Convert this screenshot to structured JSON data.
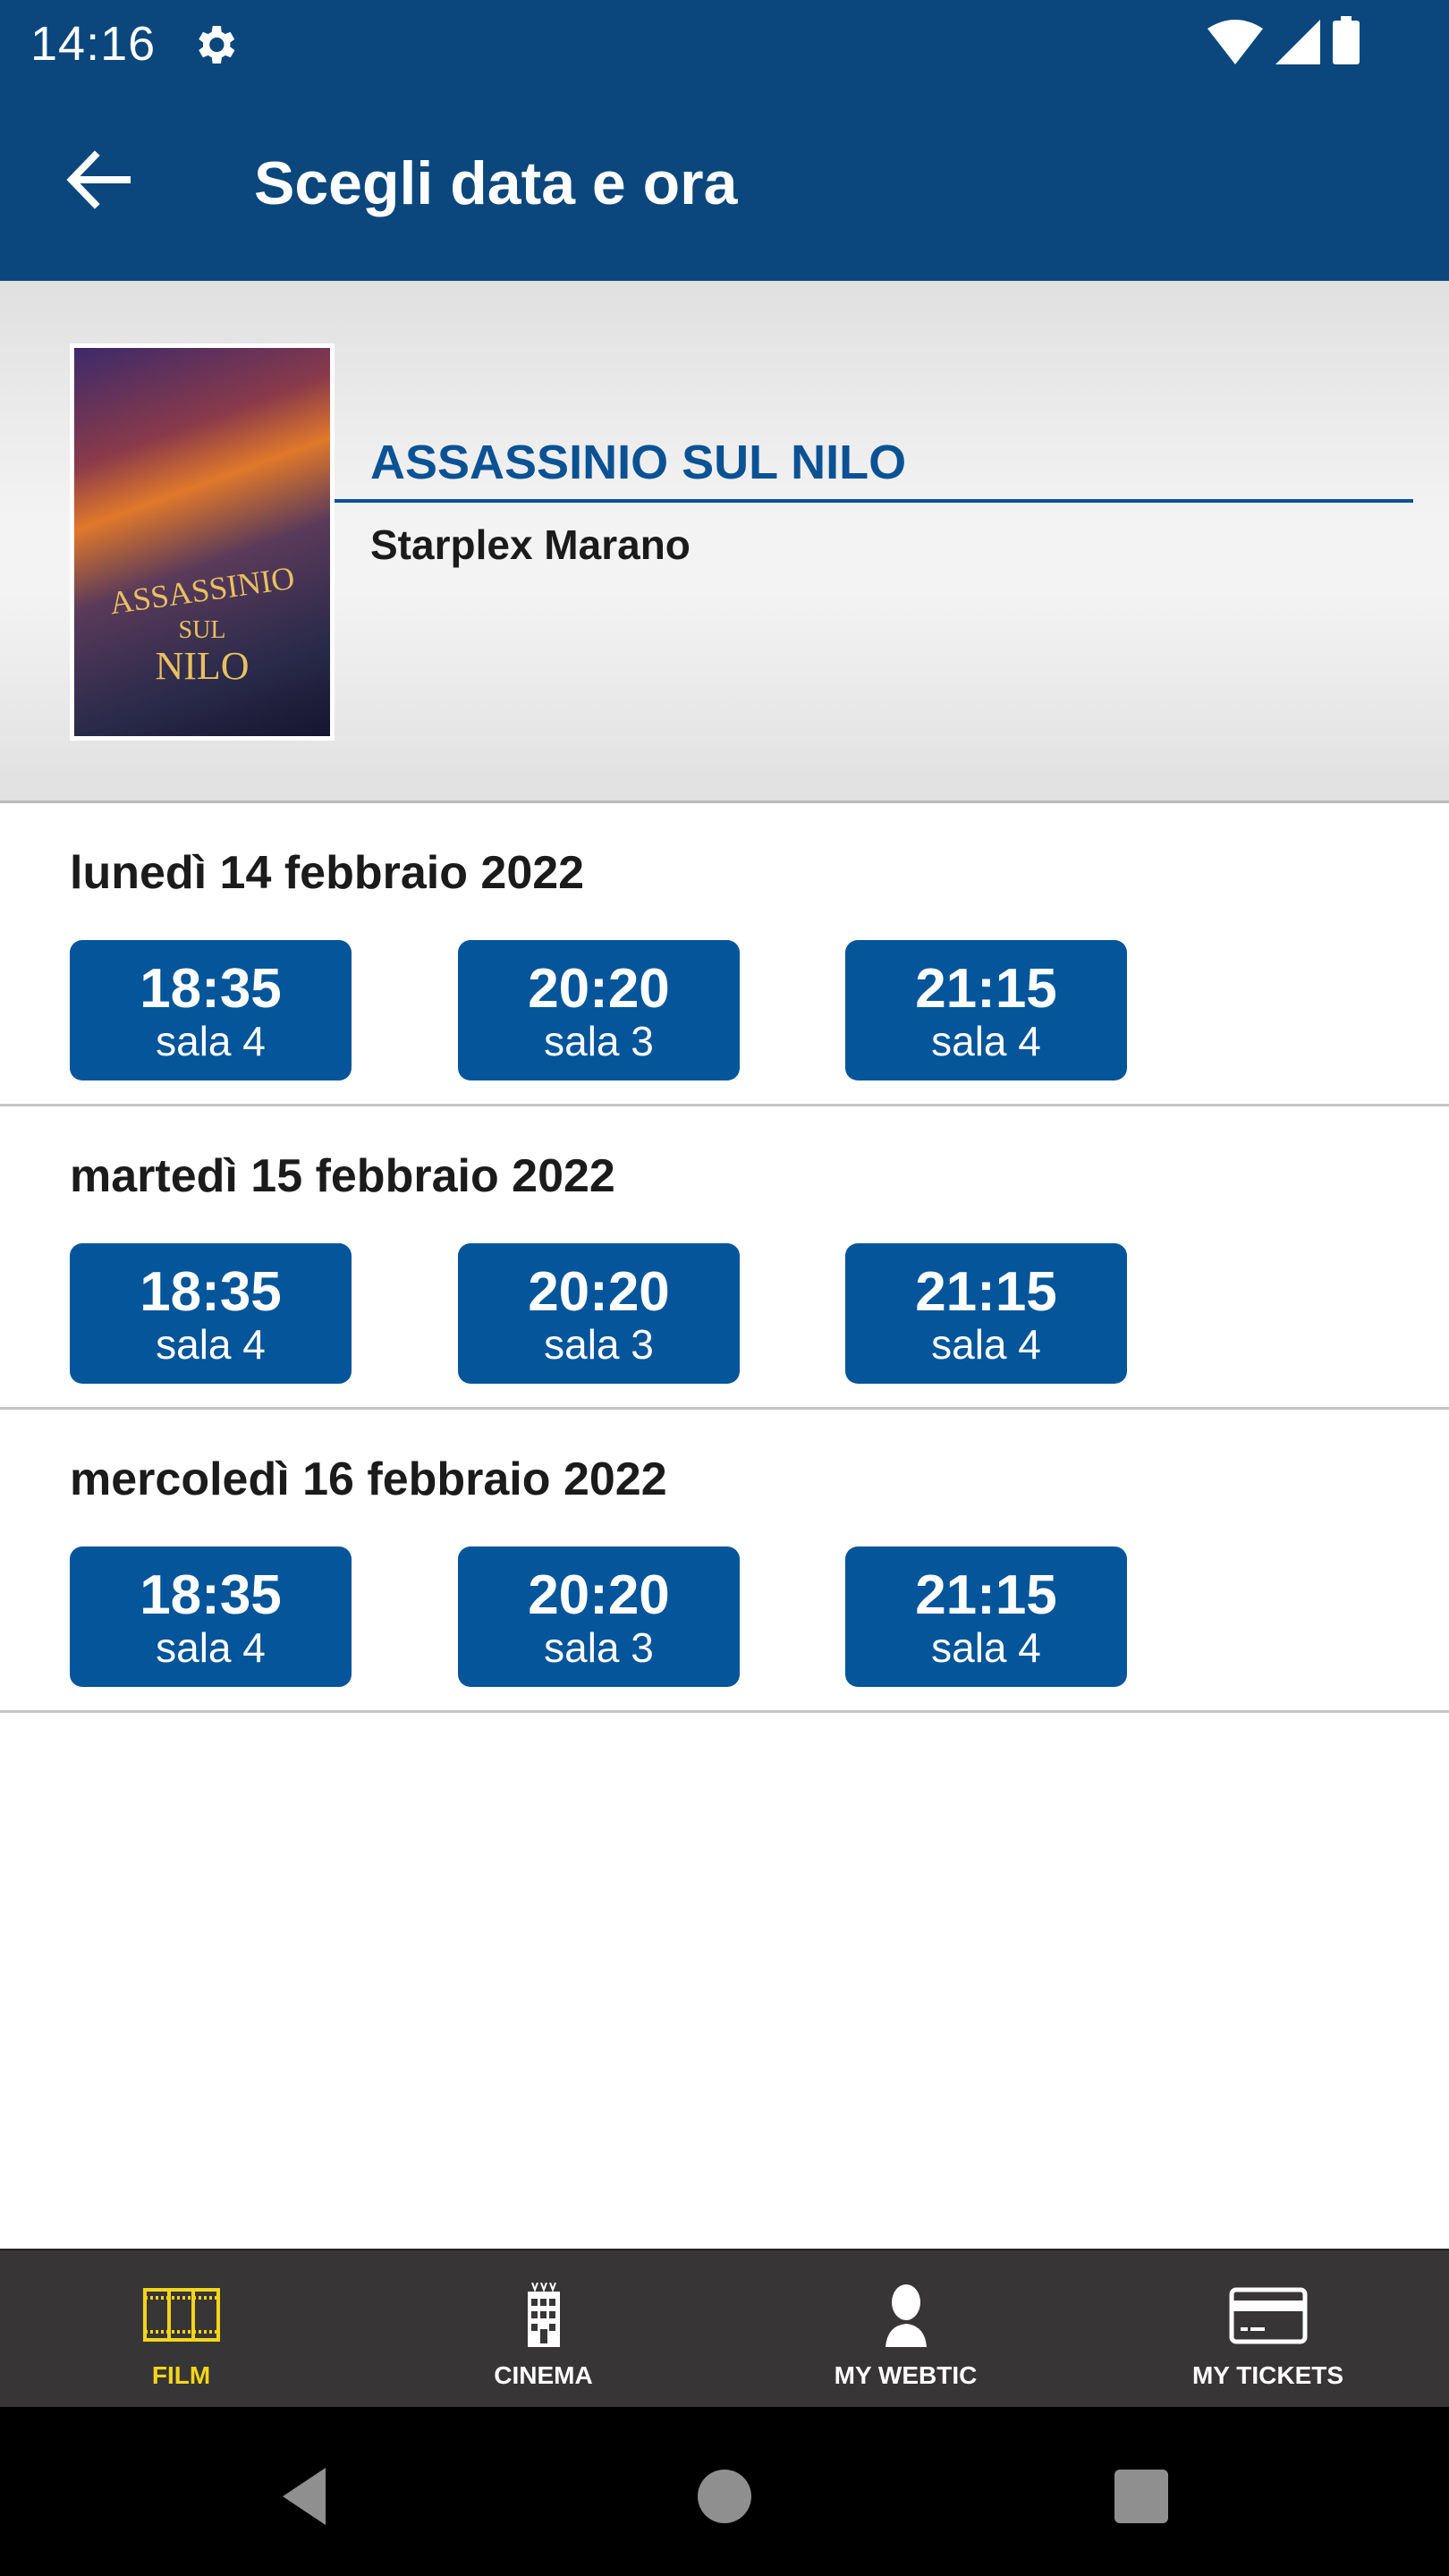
{
  "status_bar": {
    "time": "14:16",
    "icons": [
      "gear-icon",
      "wifi-icon",
      "signal-icon",
      "battery-icon"
    ]
  },
  "app_bar": {
    "title": "Scegli data e ora",
    "back_icon": "arrow-left-icon"
  },
  "movie": {
    "title": "ASSASSINIO SUL NILO",
    "cinema": "Starplex Marano",
    "poster_text": [
      "ASSASSINIO",
      "SUL",
      "NILO"
    ]
  },
  "colors": {
    "primary": "#0b477c",
    "button": "#04559a",
    "title_blue": "#0a5294",
    "nav_bg": "#373535",
    "nav_active": "#f3d51b"
  },
  "days": [
    {
      "date": "lunedì 14 febbraio 2022",
      "showtimes": [
        {
          "time": "18:35",
          "room": "sala 4"
        },
        {
          "time": "20:20",
          "room": "sala 3"
        },
        {
          "time": "21:15",
          "room": "sala 4"
        }
      ]
    },
    {
      "date": "martedì 15 febbraio 2022",
      "showtimes": [
        {
          "time": "18:35",
          "room": "sala 4"
        },
        {
          "time": "20:20",
          "room": "sala 3"
        },
        {
          "time": "21:15",
          "room": "sala 4"
        }
      ]
    },
    {
      "date": "mercoledì 16 febbraio 2022",
      "showtimes": [
        {
          "time": "18:35",
          "room": "sala 4"
        },
        {
          "time": "20:20",
          "room": "sala 3"
        },
        {
          "time": "21:15",
          "room": "sala 4"
        }
      ]
    }
  ],
  "bottom_nav": [
    {
      "label": "FILM",
      "icon": "film-strip-icon",
      "active": true
    },
    {
      "label": "CINEMA",
      "icon": "building-icon",
      "active": false
    },
    {
      "label": "MY WEBTIC",
      "icon": "user-icon",
      "active": false
    },
    {
      "label": "MY TICKETS",
      "icon": "credit-card-icon",
      "active": false
    }
  ],
  "system_nav": [
    "back-triangle-icon",
    "home-circle-icon",
    "recents-square-icon"
  ]
}
